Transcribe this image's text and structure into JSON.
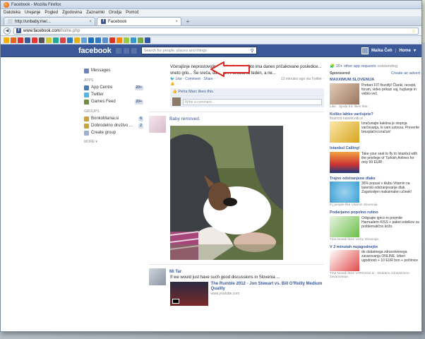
{
  "window": {
    "title": "Facebook - Mozilla Firefox",
    "menu": [
      "Datoteka",
      "Urejanje",
      "Pogled",
      "Zgodovina",
      "Zaznamki",
      "Orodja",
      "Pomoč"
    ]
  },
  "tabs": [
    {
      "label": "http://unbaby.me/...",
      "active": false
    },
    {
      "label": "Facebook",
      "active": true
    }
  ],
  "url": {
    "host": "www.facebook.com",
    "path": "/home.php"
  },
  "fb": {
    "logo": "facebook",
    "search_placeholder": "Search for people, places and things",
    "user_name": "Maika Čeh",
    "home": "Home"
  },
  "left": {
    "messages": "Messages",
    "apps_head": "APPS",
    "apps": [
      {
        "label": "App Centre",
        "count": "20+"
      },
      {
        "label": "Twitter",
        "count": ""
      },
      {
        "label": "Games Feed",
        "count": "20+"
      }
    ],
    "groups_head": "GROUPS",
    "groups": [
      {
        "label": "BonkoMania.si",
        "count": "6"
      },
      {
        "label": "Dobrodelno društvo ...",
        "count": "2"
      },
      {
        "label": "Create group",
        "count": ""
      }
    ],
    "more": "MORE ▾"
  },
  "feed": {
    "post1_text": "Včerajšnje neprostovoljno druženje z nevihto ima danes pričakovane posledice... vneto grlo... Še sreča, da imam Poročila ta teden, a ne...",
    "post1_actions": "Like · Comment · Share ·",
    "post1_time": "13 minutes ago via Twitter ·",
    "post1_likes": "Petra Marc likes this.",
    "comment_placeholder": "Write a comment...",
    "post2_title": "Baby removed.",
    "post3_name": "Mi Tar",
    "post3_text": "If we would just have such good discussions in Slovenia ...",
    "link_title": "The Rumble 2012 - Jon Stewart vs. Bill O'Reilly Medium Quality",
    "link_url": "www.youtube.com"
  },
  "right": {
    "top_link": "20+ other app requests",
    "top_suffix": "outstanding",
    "sponsored": "Sponsored",
    "create_ad": "Create an advert",
    "ads": [
      {
        "title": "MAXXIMUM SLOVENIJA",
        "sub": "",
        "text": "Preberi FIT flozofiji! Članki, recepti, forum, video prikazi vaj, hujšanje in veliko več.",
        "social": "Like · Sjeda Kiz likes this."
      },
      {
        "title": "Koliko lahko varčujete?",
        "sub": "financni-nasvet.nib.si",
        "text": "Izračunajte kakšna je stopnja varčevanja, ki vam ustreza. Preverite brezplačni izračun!",
        "social": ""
      },
      {
        "title": "Istanbul Calling!",
        "sub": "",
        "text": "Take your seat to fly to Istanbul with the privilege of Turkish Airlines for only 99 EUR!",
        "social": ""
      },
      {
        "title": "Trajno odstranjene dlake",
        "sub": "",
        "text": "35% popust v klubu Vitamin na laserski odstranjevanje dlak. Zagotovljen maksimalen učinek!",
        "social": "8 j people like Vitamin Slovenija."
      },
      {
        "title": "Podarjamo popolno rutino",
        "sub": "",
        "text": "Odigrajte igrico in prejmite Harmadern KISS + paket izdelkov za problematično kožo.",
        "social": "Tina Novak likes Vichy Slovenija."
      },
      {
        "title": "V 2 minutah nujagodnejše",
        "sub": "",
        "text": "do dodatnega zdravstvenega zavarovanja ONLINE. Izberi ugodnosti + 10 EUR bon + počitnice",
        "social": "Tina Novak likes VAROU32.si - Dodatno zdravstveno zavarovanje."
      }
    ]
  },
  "colors": {
    "fb_blue": "#3b5998",
    "arrow_red": "#d8261e"
  }
}
